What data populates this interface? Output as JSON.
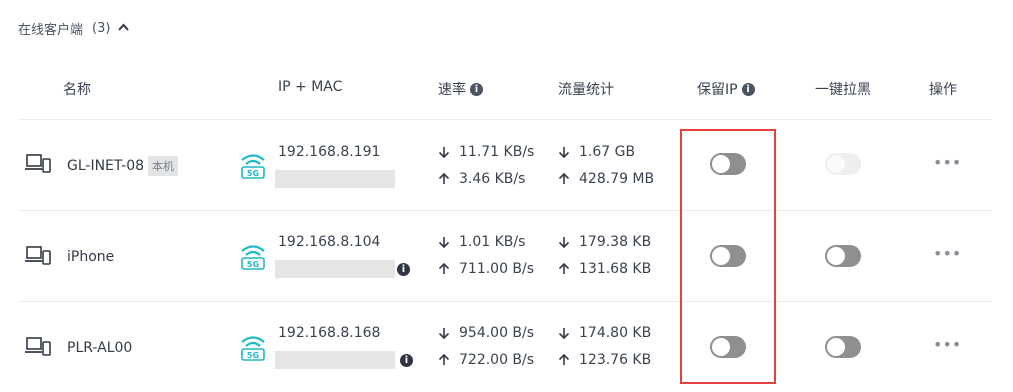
{
  "section": {
    "title": "在线客户端",
    "count": "(3)",
    "expanded": true
  },
  "headers": {
    "name": "名称",
    "ip_mac": "IP + MAC",
    "rate": "速率",
    "traffic": "流量统计",
    "reserve_ip": "保留IP",
    "block": "一键拉黑",
    "actions": "操作"
  },
  "clients": [
    {
      "name": "GL-INET-08",
      "badge": "本机",
      "band": "5G",
      "ip": "192.168.8.191",
      "down_rate": "11.71 KB/s",
      "up_rate": "3.46 KB/s",
      "down_total": "1.67 GB",
      "up_total": "428.79 MB",
      "reserve_ip_on": false,
      "block_enabled": false,
      "more": "•••"
    },
    {
      "name": "iPhone",
      "band": "5G",
      "ip": "192.168.8.104",
      "down_rate": "1.01 KB/s",
      "up_rate": "711.00 B/s",
      "down_total": "179.38 KB",
      "up_total": "131.68 KB",
      "reserve_ip_on": false,
      "block_enabled": true,
      "more": "•••"
    },
    {
      "name": "PLR-AL00",
      "band": "5G",
      "ip": "192.168.8.168",
      "down_rate": "954.00 B/s",
      "up_rate": "722.00 B/s",
      "down_total": "174.80 KB",
      "up_total": "123.76 KB",
      "reserve_ip_on": false,
      "block_enabled": true,
      "more": "•••"
    }
  ],
  "icons": {
    "info": "i",
    "device": "device-icon",
    "wifi": "wifi-5g-icon",
    "down": "arrow-down-icon",
    "up": "arrow-up-icon",
    "collapse": "chevron-up-icon"
  },
  "colors": {
    "accent": "#1fb8c4",
    "highlight": "#e5413f",
    "toggle_off": "#8f8f8f"
  }
}
